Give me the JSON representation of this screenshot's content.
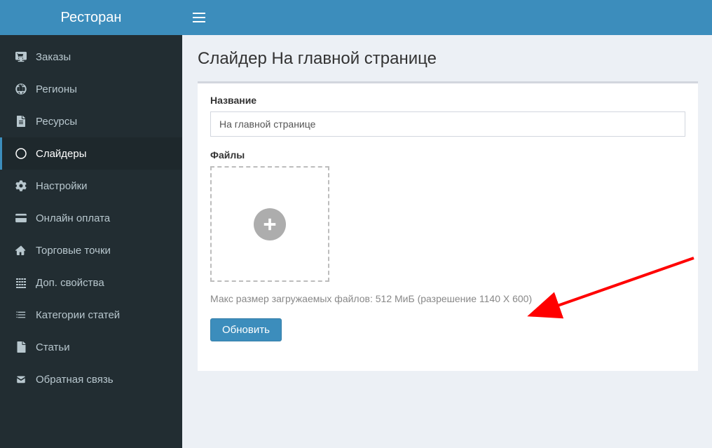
{
  "app": {
    "brand": "Ресторан"
  },
  "sidebar": {
    "items": [
      {
        "label": "Заказы"
      },
      {
        "label": "Регионы"
      },
      {
        "label": "Ресурсы"
      },
      {
        "label": "Слайдеры"
      },
      {
        "label": "Настройки"
      },
      {
        "label": "Онлайн оплата"
      },
      {
        "label": "Торговые точки"
      },
      {
        "label": "Доп. свойства"
      },
      {
        "label": "Категории статей"
      },
      {
        "label": "Статьи"
      },
      {
        "label": "Обратная связь"
      }
    ]
  },
  "main": {
    "page_title": "Слайдер На главной странице",
    "name_label": "Название",
    "name_value": "На главной странице",
    "files_label": "Файлы",
    "hint": "Макс размер загружаемых файлов: 512 МиБ (разрешение 1140 X 600)",
    "update_button": "Обновить"
  }
}
